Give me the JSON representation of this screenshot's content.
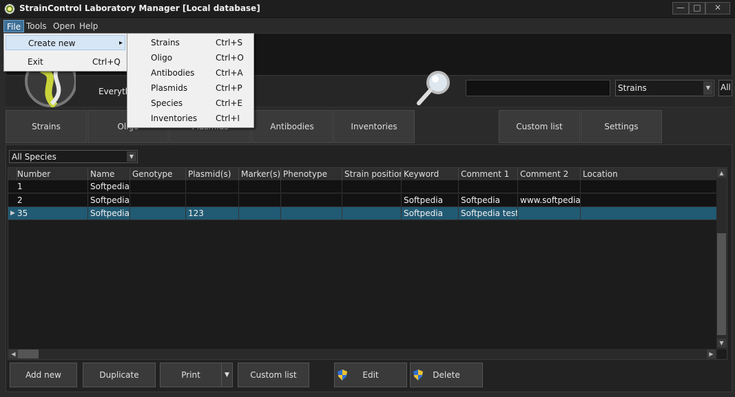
{
  "window": {
    "title": "StrainControl Laboratory Manager [Local database]",
    "buttons": {
      "minimize": "—",
      "maximize": "□",
      "close": "✕"
    }
  },
  "menubar": {
    "items": [
      "File",
      "Tools",
      "Open",
      "Help"
    ]
  },
  "file_menu": {
    "items": [
      {
        "label": "Create new",
        "shortcut": "",
        "arrow": "▸"
      },
      {
        "label": "Exit",
        "shortcut": "Ctrl+Q"
      }
    ]
  },
  "create_new_submenu": {
    "items": [
      {
        "label": "Strains",
        "shortcut": "Ctrl+S"
      },
      {
        "label": "Oligo",
        "shortcut": "Ctrl+O"
      },
      {
        "label": "Antibodies",
        "shortcut": "Ctrl+A"
      },
      {
        "label": "Plasmids",
        "shortcut": "Ctrl+P"
      },
      {
        "label": "Species",
        "shortcut": "Ctrl+E"
      },
      {
        "label": "Inventories",
        "shortcut": "Ctrl+I"
      }
    ]
  },
  "header": {
    "tagline": "Everyth",
    "search_value": "",
    "search_category": "Strains",
    "scope": "All"
  },
  "tabs": [
    "Strains",
    "Oligo",
    "Plasmids",
    "Antibodies",
    "Inventories",
    "Custom list",
    "Settings"
  ],
  "species_filter": "All Species",
  "grid": {
    "columns": [
      "Number",
      "Name",
      "Genotype",
      "Plasmid(s)",
      "Marker(s)",
      "Phenotype",
      "Strain position",
      "Keyword",
      "Comment 1",
      "Comment 2",
      "Location"
    ],
    "rows": [
      [
        "1",
        "Softpedia t",
        "",
        "",
        "",
        "",
        "",
        "",
        "",
        "",
        ""
      ],
      [
        "2",
        "Softpedia",
        "",
        "",
        "",
        "",
        "",
        "Softpedia",
        "Softpedia",
        "www.softpedia.",
        ""
      ],
      [
        "35",
        "Softpedia",
        "",
        "123",
        "",
        "",
        "",
        "Softpedia",
        "Softpedia test",
        "",
        ""
      ]
    ],
    "selected_row": 2,
    "row_indicator": "▶"
  },
  "buttons": {
    "add_new": "Add new",
    "duplicate": "Duplicate",
    "print": "Print",
    "custom_list": "Custom list",
    "edit": "Edit",
    "delete": "Delete"
  },
  "colors": {
    "selected_row": "#215a73",
    "menu_highlight": "#3e6f96",
    "background": "#2b2b2b"
  }
}
